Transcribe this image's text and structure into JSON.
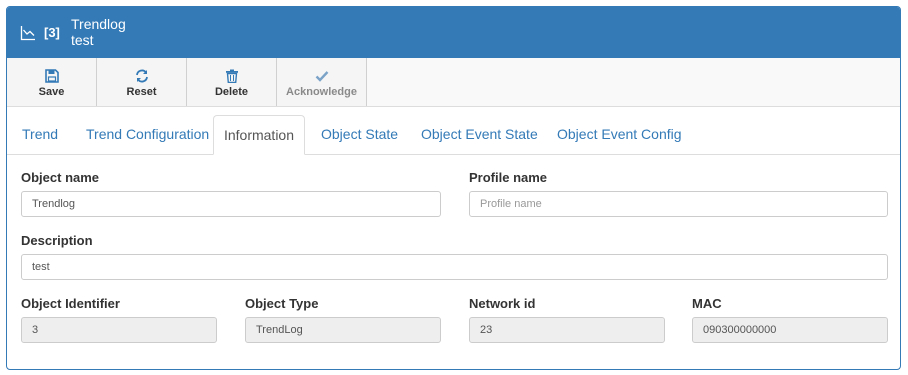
{
  "header": {
    "id_label": "[3]",
    "title_line1": "Trendlog",
    "title_line2": "test",
    "icon": "chart-line-icon"
  },
  "toolbar": {
    "save_label": "Save",
    "reset_label": "Reset",
    "delete_label": "Delete",
    "acknowledge_label": "Acknowledge"
  },
  "tabs": [
    {
      "label": "Trend",
      "active": false
    },
    {
      "label": "Trend Configuration",
      "active": false
    },
    {
      "label": "Information",
      "active": true
    },
    {
      "label": "Object State",
      "active": false
    },
    {
      "label": "Object Event State",
      "active": false
    },
    {
      "label": "Object Event Config",
      "active": false
    }
  ],
  "form": {
    "object_name": {
      "label": "Object name",
      "value": "Trendlog"
    },
    "profile_name": {
      "label": "Profile name",
      "value": "",
      "placeholder": "Profile name"
    },
    "description": {
      "label": "Description",
      "value": "test"
    },
    "object_identifier": {
      "label": "Object Identifier",
      "value": "3"
    },
    "object_type": {
      "label": "Object Type",
      "value": "TrendLog"
    },
    "network_id": {
      "label": "Network id",
      "value": "23"
    },
    "mac": {
      "label": "MAC",
      "value": "090300000000"
    }
  },
  "colors": {
    "primary": "#337ab7",
    "readonly_bg": "#eeeeee",
    "border": "#cccccc"
  }
}
